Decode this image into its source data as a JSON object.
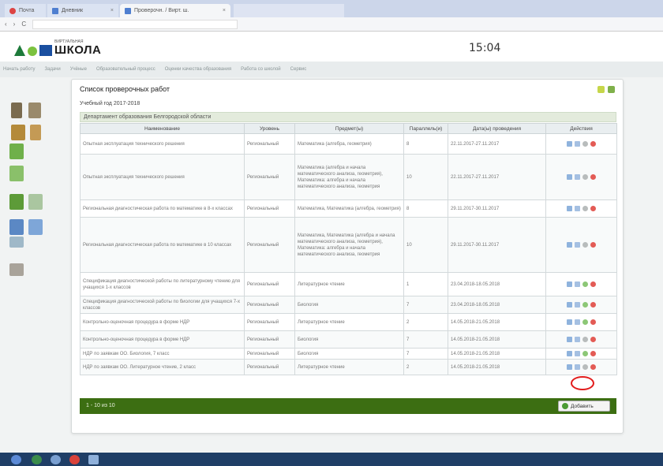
{
  "browser": {
    "tabs": [
      "Почта",
      "Дневник",
      "Проверочн. / Вирт. ш."
    ],
    "tab_close": "×",
    "address": "",
    "nav_back": "‹",
    "nav_fwd": "›",
    "nav_reload": "C"
  },
  "header": {
    "logo_small": "ВИРТУАЛЬНАЯ",
    "logo_big": "ШКОЛА",
    "time": "15:04"
  },
  "topnav": [
    "Начать работу",
    "Задачи",
    "Учёные",
    "Образовательный процесс",
    "Оценки качества образования",
    "Работа со школой",
    "Сервис"
  ],
  "panel": {
    "title": "Список проверочных работ",
    "year": "Учебный год 2017-2018",
    "dept": "Департамент образования Белгородской области",
    "columns": [
      "Наименование",
      "Уровень",
      "Предмет(ы)",
      "Параллель(и)",
      "Дата(ы) проведения",
      "Действия"
    ],
    "rows": [
      {
        "name": "Опытная эксплуатация технического решения",
        "level": "Региональный",
        "subject": "Математика (алгебра, геометрия)",
        "grade": "8",
        "dates": "22.11.2017-27.11.2017",
        "ok": false
      },
      {
        "name": "Опытная эксплуатация технического решения",
        "level": "Региональный",
        "subject": "Математика (алгебра и начала математического анализа, геометрия), Математика: алгебра и начала математического анализа, геометрия",
        "grade": "10",
        "dates": "22.11.2017-27.11.2017",
        "ok": false
      },
      {
        "name": "Региональная диагностическая работа по математике в 8-х классах",
        "level": "Региональный",
        "subject": "Математика, Математика (алгебра, геометрия)",
        "grade": "8",
        "dates": "29.11.2017-30.11.2017",
        "ok": false
      },
      {
        "name": "Региональная диагностическая работа по математике в 10 классах",
        "level": "Региональный",
        "subject": "Математика, Математика (алгебра и начала математического анализа, геометрия), Математика: алгебра и начала математического анализа, геометрия",
        "grade": "10",
        "dates": "29.11.2017-30.11.2017",
        "ok": false
      },
      {
        "name": "Спецификация диагностической работы по литературному чтению для учащихся 1-х классов",
        "level": "Региональный",
        "subject": "Литературное чтение",
        "grade": "1",
        "dates": "23.04.2018-18.05.2018",
        "ok": true
      },
      {
        "name": "Спецификация диагностической работы по биологии для учащихся 7-х классов",
        "level": "Региональный",
        "subject": "Биология",
        "grade": "7",
        "dates": "23.04.2018-18.05.2018",
        "ok": true
      },
      {
        "name": "Контрольно-оценочная процедура в форме НДР",
        "level": "Региональный",
        "subject": "Литературное чтение",
        "grade": "2",
        "dates": "14.05.2018-21.05.2018",
        "ok": true
      },
      {
        "name": "Контрольно-оценочная процедура в форме НДР",
        "level": "Региональный",
        "subject": "Биология",
        "grade": "7",
        "dates": "14.05.2018-21.05.2018",
        "ok": false
      },
      {
        "name": "НДР по заявкам ОО. Биология, 7 класс",
        "level": "Региональный",
        "subject": "Биология",
        "grade": "7",
        "dates": "14.05.2018-21.05.2018",
        "ok": true
      },
      {
        "name": "НДР по заявкам ОО. Литературное чтение, 2 класс",
        "level": "Региональный",
        "subject": "Литературное чтение",
        "grade": "2",
        "dates": "14.05.2018-21.05.2018",
        "ok": false
      }
    ],
    "pager": "1 - 10 из 10",
    "add_label": "Добавить"
  },
  "colors": {
    "footer": "#3c6e12",
    "dept_bg": "#e3ebdc",
    "highlight": "#e21c1c"
  }
}
